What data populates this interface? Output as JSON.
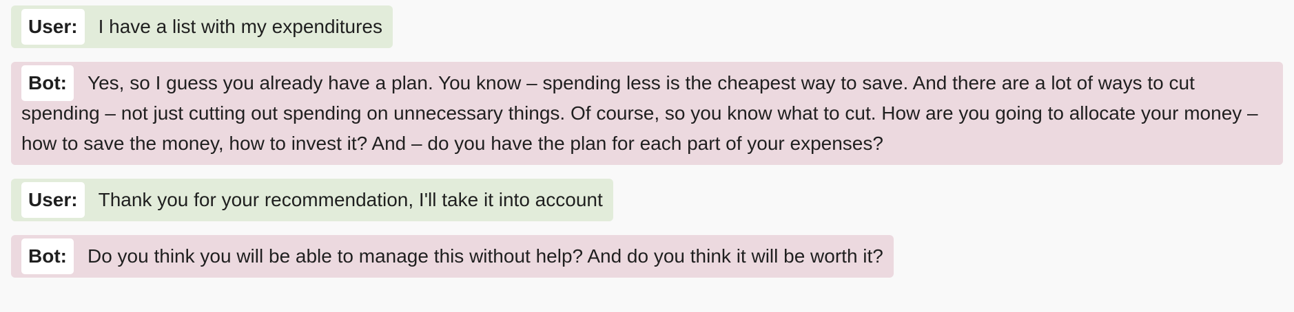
{
  "messages": [
    {
      "role": "User:",
      "text": "I have a list with my expenditures"
    },
    {
      "role": "Bot:",
      "text": "Yes, so I guess you already have a plan. You know – spending less is the cheapest way to save. And there are a lot of ways to cut spending – not just cutting out spending on unnecessary things. Of course, so you know what to cut. How are you going to allocate your money – how to save the money, how to invest it? And – do you have the plan for each part of your expenses?"
    },
    {
      "role": "User:",
      "text": "Thank you for your recommendation, I'll take it into account"
    },
    {
      "role": "Bot:",
      "text": "Do you think you will be able to manage this without help? And do you think it will be worth it?"
    }
  ],
  "colors": {
    "background": "#f9f9f9",
    "user_bubble": "#e2ecda",
    "bot_bubble": "#ecd9df",
    "role_tag": "#ffffff"
  }
}
